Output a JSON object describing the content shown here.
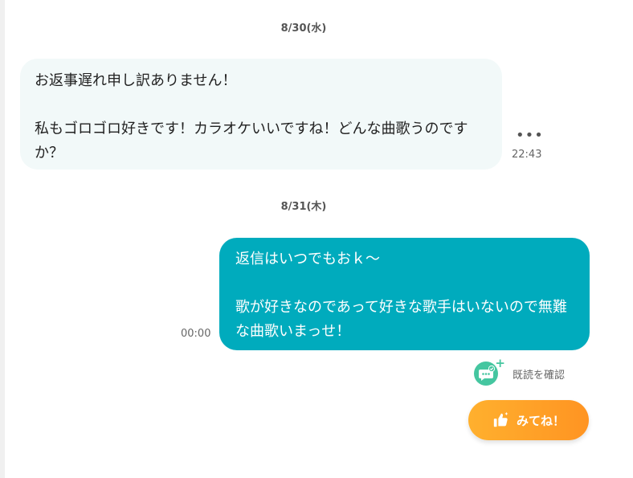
{
  "messages": [
    {
      "date": "8/30(水)",
      "direction": "incoming",
      "paragraphs": [
        "お返事遅れ申し訳ありません！",
        "私もゴロゴロ好きです！カラオケいいですね！どんな曲歌うのですか？"
      ],
      "time": "22:43",
      "more_icon": "ellipsis-icon"
    },
    {
      "date": "8/31(木)",
      "direction": "outgoing",
      "paragraphs": [
        "返信はいつでもおｋ～",
        "歌が好きなのであって好きな歌手はいないので無難な曲歌いまっせ！"
      ],
      "time": "00:00"
    }
  ],
  "read_receipt": {
    "label": "既読を確認",
    "icon": "chat-check-icon",
    "badge": "+"
  },
  "like_button": {
    "label": "みてね！",
    "icon": "thumbs-up-icon"
  },
  "colors": {
    "incoming_bubble": "#f2f9f9",
    "outgoing_bubble": "#00abbd",
    "read_icon": "#45c6a0",
    "like_gradient_start": "#ffb02e",
    "like_gradient_end": "#ff9422"
  }
}
